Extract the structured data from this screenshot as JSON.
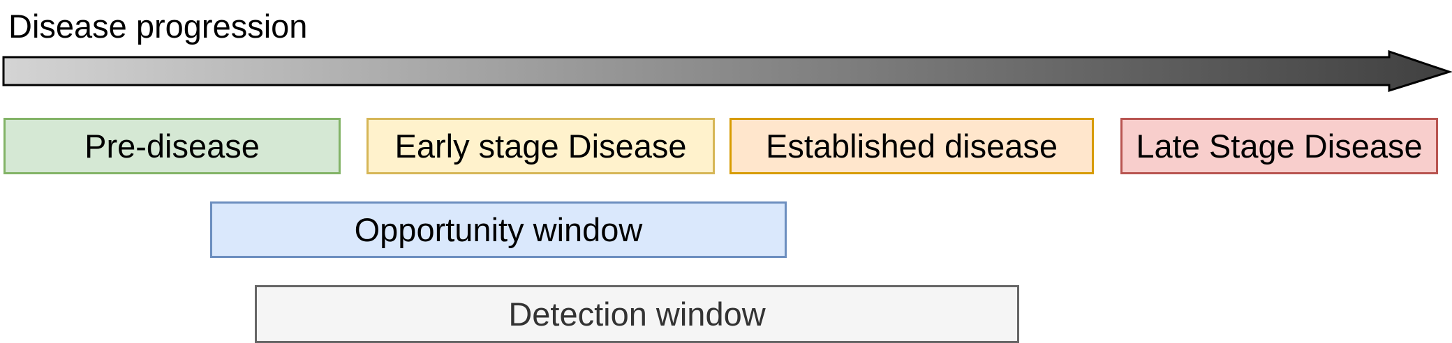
{
  "title": "Disease progression",
  "stages": [
    {
      "id": "pre",
      "label": "Pre-disease",
      "fill": "#d5e8d4",
      "stroke": "#82b366",
      "text_color": "#000000"
    },
    {
      "id": "early",
      "label": "Early stage Disease",
      "fill": "#fff2cc",
      "stroke": "#d6b656",
      "text_color": "#000000"
    },
    {
      "id": "established",
      "label": "Established disease",
      "fill": "#ffe6cc",
      "stroke": "#d79b00",
      "text_color": "#000000"
    },
    {
      "id": "late",
      "label": "Late Stage Disease",
      "fill": "#f8cecc",
      "stroke": "#b85450",
      "text_color": "#000000"
    }
  ],
  "windows": [
    {
      "id": "opportunity",
      "label": "Opportunity window",
      "fill": "#dae8fc",
      "stroke": "#6c8ebf",
      "text_color": "#000000"
    },
    {
      "id": "detection",
      "label": "Detection window",
      "fill": "#f5f5f5",
      "stroke": "#666666",
      "text_color": "#333333"
    }
  ],
  "arrow_colors": {
    "start": "#d4d4d4",
    "end": "#404040",
    "stroke": "#000000"
  }
}
